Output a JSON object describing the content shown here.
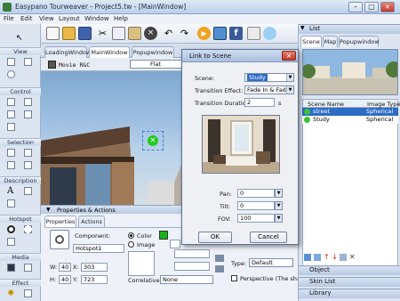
{
  "window": {
    "title": "Easypano Tourweaver - Project5.tw - [MainWindow]",
    "minimize": "–",
    "maximize": "□",
    "close": "×"
  },
  "menubar": [
    "File",
    "Edit",
    "View",
    "Layout",
    "Window",
    "Help"
  ],
  "left_panel": {
    "sections": [
      "View",
      "Control",
      "Selection",
      "Description",
      "Hotspot",
      "Media",
      "Effect"
    ]
  },
  "tabs": [
    "LoadingWindow",
    "MainWindow",
    "Popupwindow"
  ],
  "viewbar": {
    "component": "Movie R&C",
    "projection": "Flat"
  },
  "properties": {
    "title": "Properties & Actions",
    "tabs": [
      "Properties",
      "Actions"
    ],
    "component_label": "Component:",
    "component_value": "Hotspot1",
    "color_label": "Color",
    "image_label": "Image",
    "w_label": "W:",
    "w_value": "40",
    "x_label": "X:",
    "x_value": "303",
    "h_label": "H:",
    "h_value": "40",
    "y_label": "Y:",
    "y_value": "723",
    "correlative_label": "Correlative:",
    "correlative_value": "None",
    "type_label": "Type:",
    "type_value": "Default",
    "perspective_label": "Perspective (The sha"
  },
  "right_panel": {
    "title": "List",
    "tabs": [
      "Scene",
      "Map",
      "Popupwindow"
    ],
    "columns": [
      "Scene Name",
      "Image Type"
    ],
    "rows": [
      {
        "name": "street",
        "type": "Spherical"
      },
      {
        "name": "Study",
        "type": "Spherical"
      }
    ],
    "bottom_sections": [
      "Object",
      "Skin List",
      "Library"
    ]
  },
  "dialog": {
    "title": "Link to Scene",
    "scene_label": "Scene:",
    "scene_value": "Study",
    "transition_label": "Transition Effect:",
    "transition_value": "Fade In & Fade Out",
    "duration_label": "Transition Duration:",
    "duration_value": "2",
    "duration_unit": "s",
    "pan_label": "Pan:",
    "pan_value": "0",
    "tilt_label": "Tilt:",
    "tilt_value": "0",
    "fov_label": "FOV:",
    "fov_value": "100",
    "ok": "OK",
    "cancel": "Cancel"
  },
  "colors": {
    "accent": "#2d6cc4",
    "selection_green": "#22cc22",
    "color_swatch": "#19b219"
  }
}
